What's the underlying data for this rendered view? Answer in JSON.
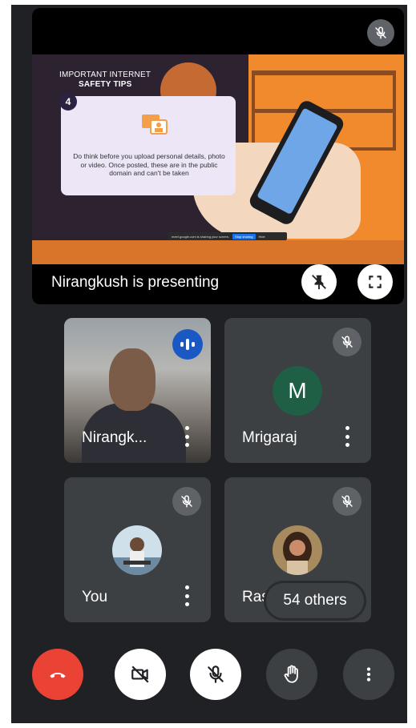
{
  "presentation": {
    "slide_heading_1": "IMPORTANT INTERNET",
    "slide_heading_2": "SAFETY TIPS",
    "tip_number": "4",
    "tip_text": "Do think before you upload personal details, photo or video. Once posted, these are in the public domain and can't be taken",
    "sharing_bar_text": "meet.google.com is sharing your screen.",
    "sharing_bar_stop": "Stop sharing",
    "sharing_bar_hide": "Hide",
    "presenter_label": "Nirangkush is presenting"
  },
  "participants": [
    {
      "name": "Nirangk...",
      "video": true,
      "speaking": true
    },
    {
      "name": "Mrigaraj",
      "avatar_letter": "M",
      "avatar_color": "#1e5f45",
      "muted": true
    },
    {
      "name": "You",
      "muted": true
    },
    {
      "name": "Rash",
      "muted": true
    }
  ],
  "others_label": "54 others",
  "controls": {
    "end_call_color": "#ea4335",
    "icons": [
      "end-call-icon",
      "camera-off-icon",
      "mic-off-icon",
      "raise-hand-icon",
      "more-options-icon"
    ]
  },
  "colors": {
    "background": "#202124",
    "tile": "#3c4043",
    "mute_badge": "#5f6368",
    "speaking_badge": "#1a59c4"
  }
}
